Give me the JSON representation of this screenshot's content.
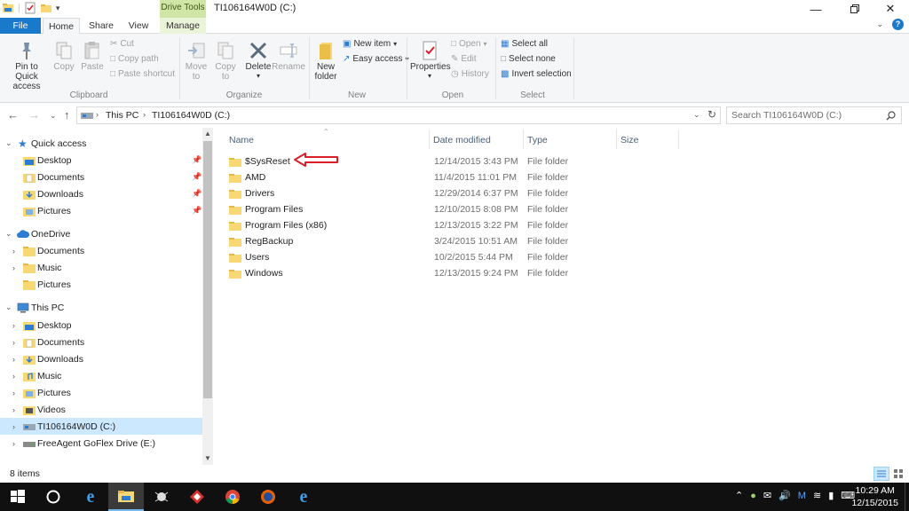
{
  "window": {
    "title": "TI106164W0D (C:)",
    "drive_tools_label": "Drive Tools"
  },
  "tabs": {
    "file": "File",
    "home": "Home",
    "share": "Share",
    "view": "View",
    "manage": "Manage"
  },
  "ribbon": {
    "clipboard": {
      "pin_line1": "Pin to Quick",
      "pin_line2": "access",
      "copy": "Copy",
      "paste": "Paste",
      "cut": "Cut",
      "copy_path": "Copy path",
      "paste_shortcut": "Paste shortcut",
      "group": "Clipboard"
    },
    "organize": {
      "move_to_line1": "Move",
      "move_to_line2": "to",
      "copy_to_line1": "Copy",
      "copy_to_line2": "to",
      "delete": "Delete",
      "rename": "Rename",
      "group": "Organize"
    },
    "new": {
      "new_folder_line1": "New",
      "new_folder_line2": "folder",
      "new_item": "New item",
      "easy_access": "Easy access",
      "group": "New"
    },
    "open": {
      "properties": "Properties",
      "open": "Open",
      "edit": "Edit",
      "history": "History",
      "group": "Open"
    },
    "select": {
      "select_all": "Select all",
      "select_none": "Select none",
      "invert_selection": "Invert selection",
      "group": "Select"
    }
  },
  "address": {
    "crumb_this_pc": "This PC",
    "crumb_drive": "TI106164W0D (C:)",
    "search_placeholder": "Search TI106164W0D (C:)"
  },
  "nav": {
    "quick_access": "Quick access",
    "qa_items": [
      "Desktop",
      "Documents",
      "Downloads",
      "Pictures"
    ],
    "onedrive": "OneDrive",
    "od_items": [
      "Documents",
      "Music",
      "Pictures"
    ],
    "this_pc": "This PC",
    "pc_items": [
      "Desktop",
      "Documents",
      "Downloads",
      "Music",
      "Pictures",
      "Videos",
      "TI106164W0D (C:)",
      "FreeAgent GoFlex Drive (E:)"
    ]
  },
  "columns": {
    "name": "Name",
    "date_modified": "Date modified",
    "type": "Type",
    "size": "Size"
  },
  "files": [
    {
      "name": "$SysReset",
      "date": "12/14/2015 3:43 PM",
      "type": "File folder"
    },
    {
      "name": "AMD",
      "date": "11/4/2015 11:01 PM",
      "type": "File folder"
    },
    {
      "name": "Drivers",
      "date": "12/29/2014 6:37 PM",
      "type": "File folder"
    },
    {
      "name": "Program Files",
      "date": "12/10/2015 8:08 PM",
      "type": "File folder"
    },
    {
      "name": "Program Files (x86)",
      "date": "12/13/2015 3:22 PM",
      "type": "File folder"
    },
    {
      "name": "RegBackup",
      "date": "3/24/2015 10:51 AM",
      "type": "File folder"
    },
    {
      "name": "Users",
      "date": "10/2/2015 5:44 PM",
      "type": "File folder"
    },
    {
      "name": "Windows",
      "date": "12/13/2015 9:24 PM",
      "type": "File folder"
    }
  ],
  "status": {
    "item_count": "8 items"
  },
  "clock": {
    "time": "10:29 AM",
    "date": "12/15/2015"
  },
  "colors": {
    "accent": "#1979ca",
    "folder": "#f8d775",
    "selection": "#cce8ff",
    "annotation_arrow": "#d9202a",
    "taskbar": "#101010"
  }
}
